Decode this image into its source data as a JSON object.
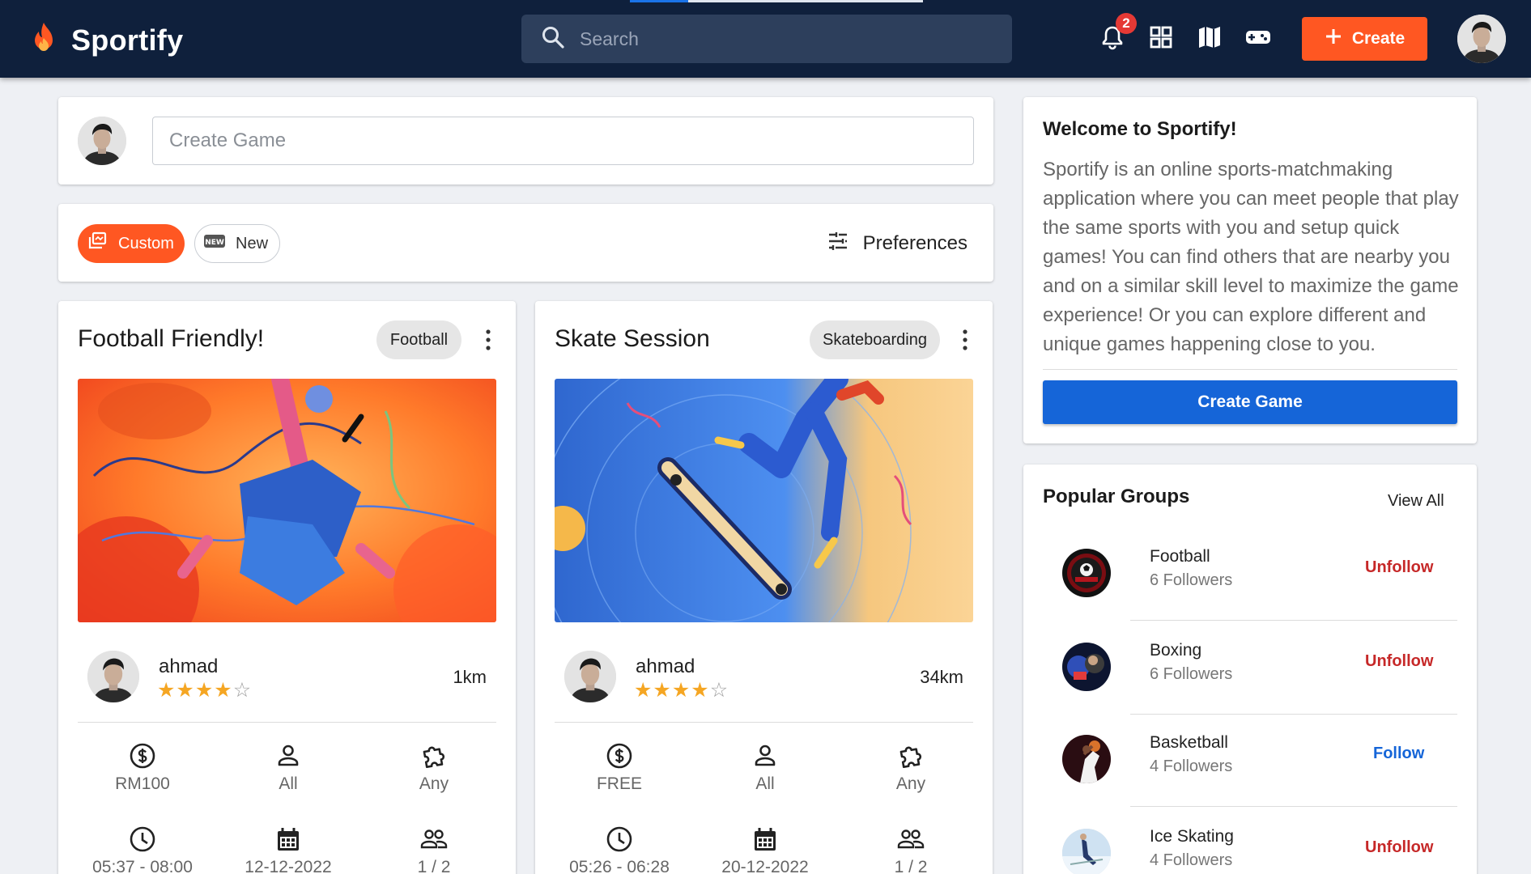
{
  "app": {
    "name": "Sportify",
    "load_progress": 0.2
  },
  "header": {
    "search_placeholder": "Search",
    "notification_count": "2",
    "create_label": "Create",
    "icons": [
      "fire-logo-icon",
      "search-icon",
      "bell-icon",
      "grid-icon",
      "map-icon",
      "gamepad-icon",
      "plus-icon"
    ]
  },
  "composer": {
    "placeholder": "Create Game"
  },
  "filters": {
    "custom_label": "Custom",
    "new_label": "New",
    "preferences_label": "Preferences"
  },
  "games": [
    {
      "title": "Football Friendly!",
      "sport": "Football",
      "host": "ahmad",
      "rating": 4,
      "rating_max": 5,
      "distance": "1km",
      "price": "RM100",
      "gender": "All",
      "skill": "Any",
      "time": "05:37 - 08:00",
      "date": "12-12-2022",
      "players": "1 / 2"
    },
    {
      "title": "Skate Session",
      "sport": "Skateboarding",
      "host": "ahmad",
      "rating": 4,
      "rating_max": 5,
      "distance": "34km",
      "price": "FREE",
      "gender": "All",
      "skill": "Any",
      "time": "05:26 - 06:28",
      "date": "20-12-2022",
      "players": "1 / 2"
    }
  ],
  "welcome": {
    "title": "Welcome to Sportify!",
    "body": "Sportify is an online sports-matchmaking application where you can meet people that play the same sports with you and setup quick games! You can find others that are nearby you and on a similar skill level to maximize the game experience! Or you can explore different and unique games happening close to you.",
    "button": "Create Game"
  },
  "groups": {
    "title": "Popular Groups",
    "view_all": "View All",
    "items": [
      {
        "name": "Football",
        "followers": "6 Followers",
        "action": "Unfollow"
      },
      {
        "name": "Boxing",
        "followers": "6 Followers",
        "action": "Unfollow"
      },
      {
        "name": "Basketball",
        "followers": "4 Followers",
        "action": "Follow"
      },
      {
        "name": "Ice Skating",
        "followers": "4 Followers",
        "action": "Unfollow"
      }
    ]
  },
  "colors": {
    "navbar": "#0f203c",
    "accent_orange": "#ff5722",
    "primary_blue": "#1565d8",
    "unfollow_red": "#c62828",
    "star_gold": "#f5a623"
  }
}
